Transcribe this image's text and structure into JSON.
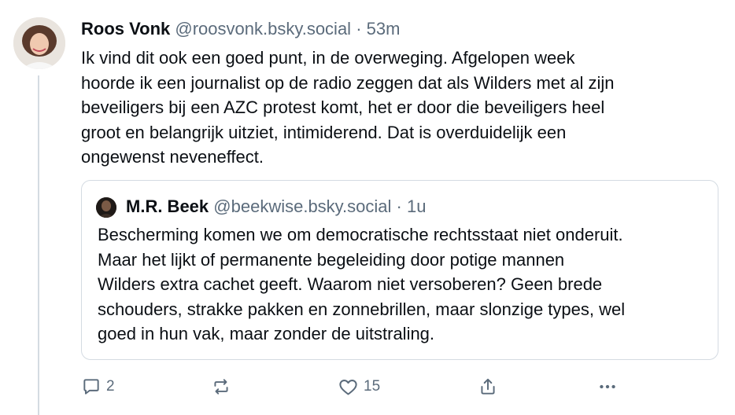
{
  "post": {
    "author_name": "Roos Vonk",
    "author_handle": "@roosvonk.bsky.social",
    "separator": "·",
    "time": "53m",
    "text": "Ik vind dit ook een goed punt, in de overweging. Afgelopen week\nhoorde ik een journalist op de radio zeggen dat als Wilders met al zijn\nbeveiligers bij een AZC protest komt, het er door die beveiligers heel\ngroot en belangrijk uitziet, intimiderend. Dat is  overduidelijk een\nongewenst neveneffect."
  },
  "quote": {
    "author_name": "M.R. Beek",
    "author_handle": "@beekwise.bsky.social",
    "separator": "·",
    "time": "1u",
    "text": "Bescherming komen we om democratische rechtsstaat niet onderuit.\nMaar het lijkt of permanente begeleiding door potige mannen\nWilders extra cachet geeft. Waarom niet versoberen? Geen brede\nschouders, strakke pakken en zonnebrillen, maar slonzige types, wel\ngoed in hun vak, maar zonder de uitstraling."
  },
  "actions": {
    "reply_icon": "reply-icon",
    "reply_count": "2",
    "repost_icon": "repost-icon",
    "like_icon": "heart-icon",
    "like_count": "15",
    "share_icon": "share-icon",
    "more_icon": "more-icon"
  },
  "colors": {
    "text": "#0b0f14",
    "muted": "#5b6b7b",
    "border": "#d4dbe2"
  }
}
